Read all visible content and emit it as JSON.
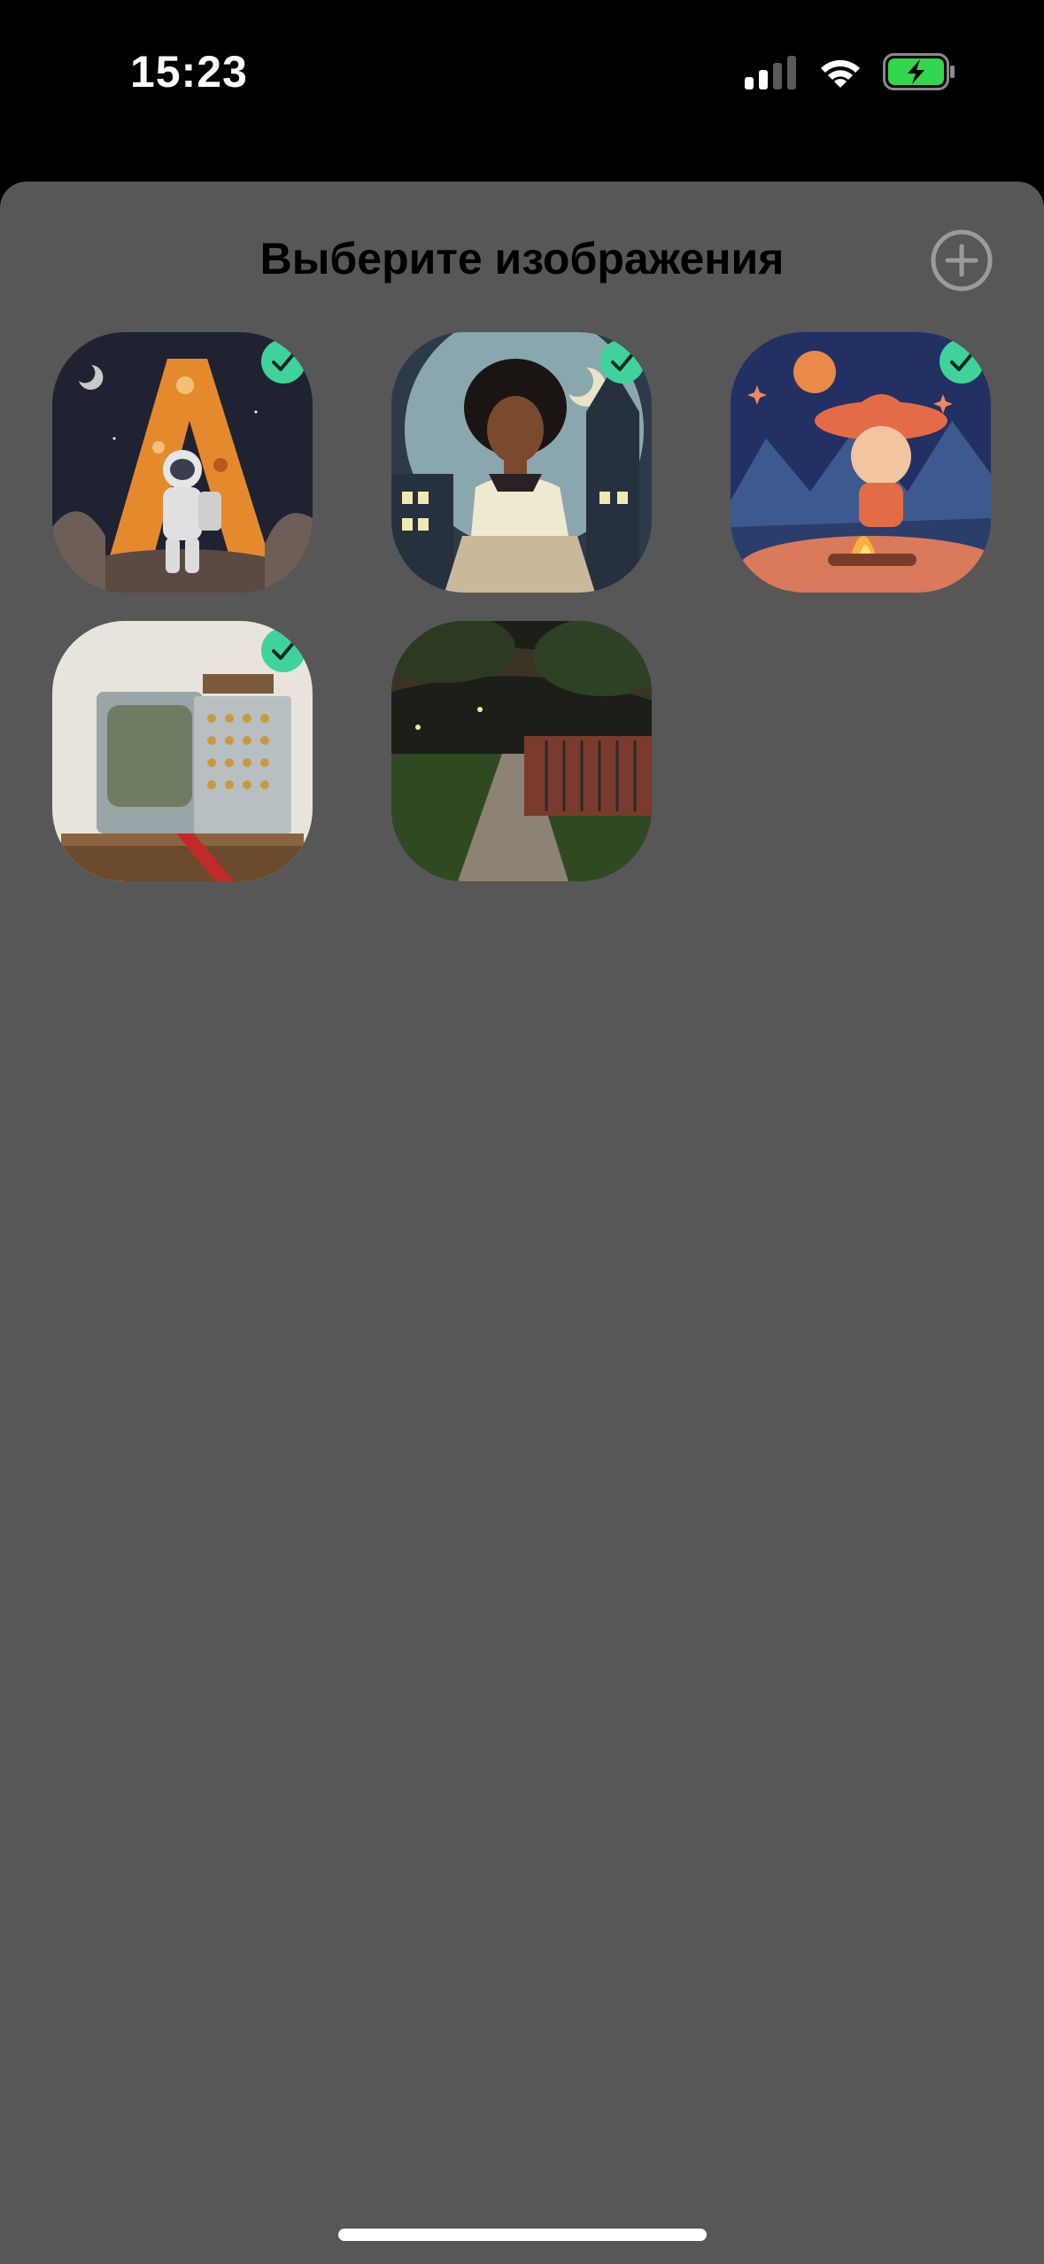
{
  "status_bar": {
    "time": "15:23",
    "icons": [
      "cellular-signal-icon",
      "wifi-icon",
      "battery-charging-icon"
    ],
    "battery_color": "#32d74b"
  },
  "sheet": {
    "title": "Выберите изображения",
    "add_icon": "plus-circle-icon",
    "background": "#575757"
  },
  "images": [
    {
      "subject": "astronaut-letter-a",
      "selected": true
    },
    {
      "subject": "woman-night-city",
      "selected": true
    },
    {
      "subject": "cowboy-campfire",
      "selected": true
    },
    {
      "subject": "retro-tv-console",
      "selected": true
    },
    {
      "subject": "night-park-path",
      "selected": false
    }
  ],
  "colors": {
    "check_badge": "#3fd39b",
    "home_indicator": "#ffffff"
  }
}
